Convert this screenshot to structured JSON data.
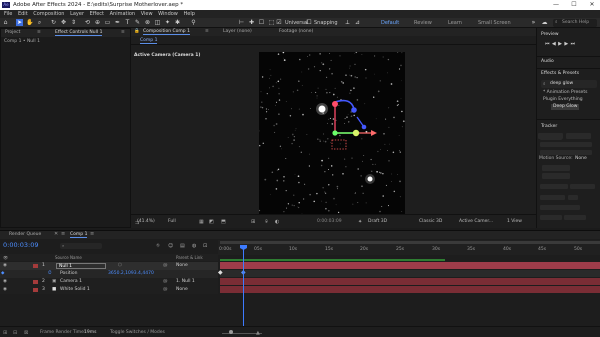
{
  "window": {
    "title": "Adobe After Effects 2024 - E:\\edits\\Surprise Motherlover.aep *",
    "logo": "Ae",
    "minimize": "—",
    "maximize": "☐",
    "close": "✕"
  },
  "menu": [
    "File",
    "Edit",
    "Composition",
    "Layer",
    "Effect",
    "Animation",
    "View",
    "Window",
    "Help"
  ],
  "toolbar": {
    "universal": "Universal",
    "snapping": "Snapping",
    "workspaces": [
      "Default",
      "Review",
      "Learn",
      "Small Screen"
    ],
    "active_workspace": "Default",
    "search_placeholder": "Search Help"
  },
  "left_panel": {
    "tabs": [
      "Project",
      "Effect Controls Null 1"
    ],
    "breadcrumb": "Comp 1 • Null 1"
  },
  "comp_panel": {
    "tabs": [
      "Composition Comp 1",
      "Layer (none)",
      "Footage (none)"
    ],
    "subtab": "Comp 1",
    "camera_label": "Active Camera (Camera 1)",
    "bottom": {
      "zoom": "(41.4%)",
      "resolution": "Full",
      "timecode": "0:00:03:09",
      "renderer": "Draft 3D",
      "renderer_mode": "Classic 3D",
      "view": "Active Camer...",
      "views": "1 View"
    }
  },
  "right_panel": {
    "preview_title": "Preview",
    "audio": "Audio",
    "effects_presets": "Effects & Presets",
    "search_value": "deep glow",
    "tree": [
      "* Animation Presets",
      "Plugin Everything",
      "Deep Glow"
    ],
    "tracker": "Tracker",
    "motion_source_label": "Motion Source:",
    "motion_source_value": "None"
  },
  "timeline": {
    "tabs": [
      "Render Queue",
      "Comp 1"
    ],
    "timecode": "0:00:03:09",
    "columns": {
      "source_name": "Source Name",
      "parent": "Parent & Link"
    },
    "layers": [
      {
        "num": "1",
        "name": "Null 1",
        "parent": "None",
        "color": "#a43b3b",
        "selected": true
      },
      {
        "num": "",
        "name": "Position",
        "parent": "",
        "value": "3650.2,1093.4,4470",
        "color": "",
        "selected": false
      },
      {
        "num": "2",
        "name": "Camera 1",
        "parent": "1. Null 1",
        "color": "#a43b3b",
        "selected": false
      },
      {
        "num": "3",
        "name": "White Solid 1",
        "parent": "None",
        "color": "#a43b3b",
        "selected": false
      }
    ],
    "ruler": [
      "0:00s",
      "05s",
      "10s",
      "15s",
      "20s",
      "25s",
      "30s",
      "35s",
      "40s",
      "45s",
      "50s"
    ],
    "footer": {
      "render_time_label": "Frame Render Time:",
      "render_time_value": "19ms",
      "toggle": "Toggle Switches / Modes"
    }
  },
  "colors": {
    "accent": "#3d6fe0",
    "layer_bar": "#7a2d35",
    "selected_bar": "#9e3c4a",
    "work_area": "#2e7d32"
  }
}
